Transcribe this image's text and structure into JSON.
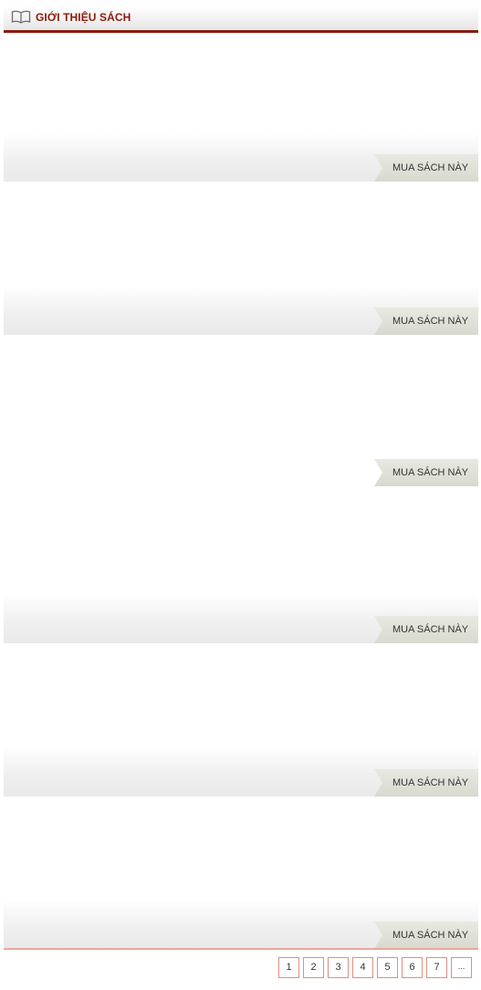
{
  "header": {
    "title": "GIỚI THIỆU SÁCH",
    "icon": "book-icon",
    "accent": "#8a1c0c"
  },
  "books": [
    {
      "buy_label": "MUA SÁCH NÀY"
    },
    {
      "buy_label": "MUA SÁCH NÀY"
    },
    {
      "buy_label": "MUA SÁCH NÀY"
    },
    {
      "buy_label": "MUA SÁCH NÀY"
    },
    {
      "buy_label": "MUA SÁCH NÀY"
    },
    {
      "buy_label": "MUA SÁCH NÀY"
    }
  ],
  "pagination": {
    "pages": [
      "1",
      "2",
      "3",
      "4",
      "5",
      "6",
      "7"
    ],
    "more": "..."
  }
}
